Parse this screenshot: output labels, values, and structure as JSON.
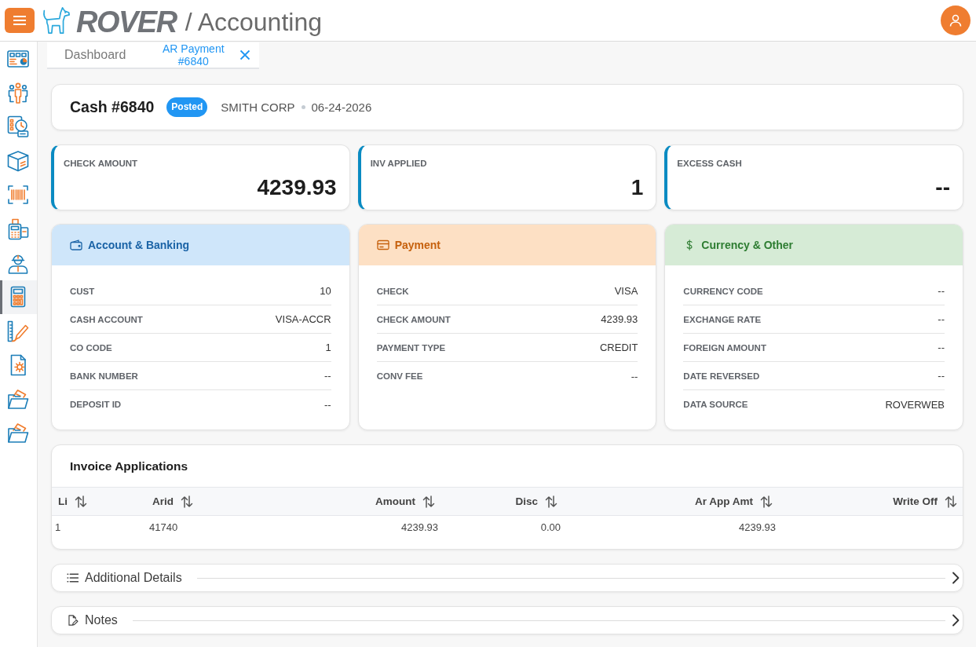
{
  "header": {
    "brand": "ROVER",
    "module": "/ Accounting"
  },
  "sidebar": {
    "items": [
      {
        "kind": "dashboard",
        "selected": false
      },
      {
        "kind": "people",
        "selected": false
      },
      {
        "kind": "schedule",
        "selected": false
      },
      {
        "kind": "package",
        "selected": false
      },
      {
        "kind": "barcode",
        "selected": false
      },
      {
        "kind": "terminal",
        "selected": false
      },
      {
        "kind": "worker",
        "selected": false
      },
      {
        "kind": "calculator",
        "selected": true
      },
      {
        "kind": "design",
        "selected": false
      },
      {
        "kind": "settings",
        "selected": false
      },
      {
        "kind": "folder",
        "selected": false
      },
      {
        "kind": "folder",
        "selected": false
      }
    ]
  },
  "tabs": [
    {
      "label": "Dashboard",
      "selected": false,
      "closable": false
    },
    {
      "label": "AR Payment #6840",
      "selected": true,
      "closable": true
    }
  ],
  "summary": {
    "title": "Cash #6840",
    "status": "Posted",
    "customer": "SMITH CORP",
    "date": "06-24-2026"
  },
  "stats": [
    {
      "label": "CHECK AMOUNT",
      "value": "4239.93"
    },
    {
      "label": "INV APPLIED",
      "value": "1"
    },
    {
      "label": "EXCESS CASH",
      "value": "--"
    }
  ],
  "sections": [
    {
      "kind": "account",
      "title": "Account & Banking",
      "fields": [
        {
          "label": "CUST",
          "value": "10"
        },
        {
          "label": "CASH ACCOUNT",
          "value": "VISA-ACCR"
        },
        {
          "label": "CO CODE",
          "value": "1"
        },
        {
          "label": "BANK NUMBER",
          "value": "--"
        },
        {
          "label": "DEPOSIT ID",
          "value": "--"
        }
      ]
    },
    {
      "kind": "payment",
      "title": "Payment",
      "fields": [
        {
          "label": "CHECK",
          "value": "VISA"
        },
        {
          "label": "CHECK AMOUNT",
          "value": "4239.93"
        },
        {
          "label": "PAYMENT TYPE",
          "value": "CREDIT"
        },
        {
          "label": "CONV FEE",
          "value": "--"
        }
      ]
    },
    {
      "kind": "currency",
      "title": "Currency & Other",
      "fields": [
        {
          "label": "CURRENCY CODE",
          "value": "--"
        },
        {
          "label": "EXCHANGE RATE",
          "value": "--"
        },
        {
          "label": "FOREIGN AMOUNT",
          "value": "--"
        },
        {
          "label": "DATE REVERSED",
          "value": "--"
        },
        {
          "label": "DATA SOURCE",
          "value": "ROVERWEB"
        }
      ]
    }
  ],
  "invoice_applications": {
    "title": "Invoice Applications",
    "columns": [
      {
        "label": "Li",
        "kind": "text"
      },
      {
        "label": "Arid",
        "kind": "text"
      },
      {
        "label": "Amount",
        "kind": "amount"
      },
      {
        "label": "Disc",
        "kind": "amount"
      },
      {
        "label": "Ar App Amt",
        "kind": "amount"
      },
      {
        "label": "Write Off",
        "kind": "amount"
      }
    ],
    "rows": [
      {
        "cells": [
          "1",
          "41740",
          "4239.93",
          "0.00",
          "4239.93"
        ]
      }
    ]
  },
  "panels": [
    {
      "kind": "details",
      "label": "Additional Details",
      "expanded": false
    },
    {
      "kind": "notes",
      "label": "Notes",
      "expanded": false
    }
  ]
}
